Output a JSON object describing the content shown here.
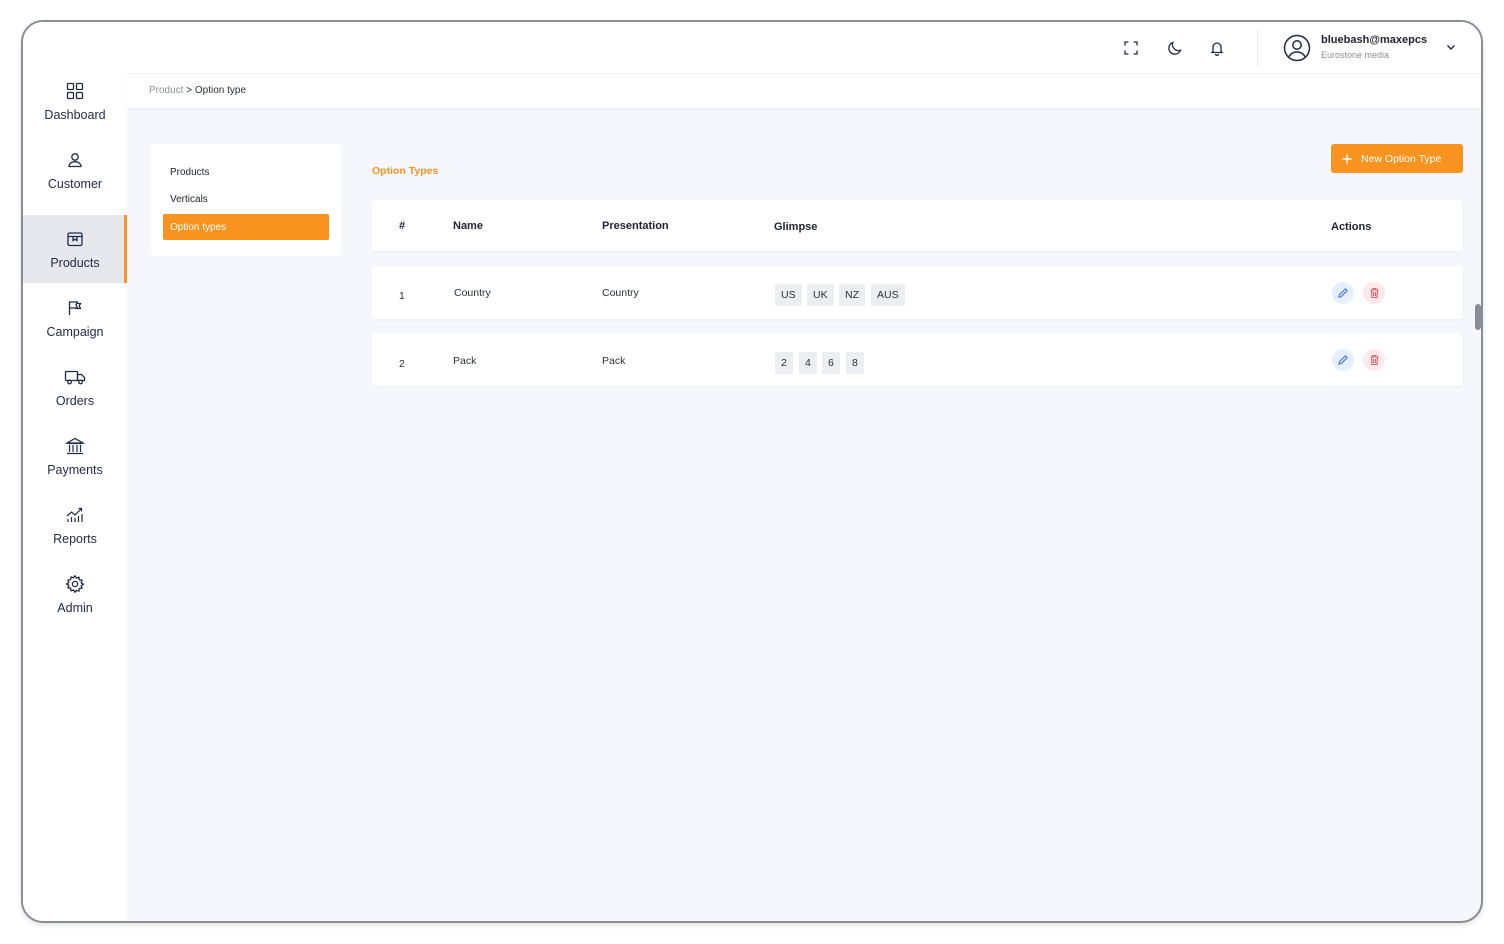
{
  "sidebar": {
    "items": [
      {
        "label": "Dashboard",
        "icon": "dashboard-icon"
      },
      {
        "label": "Customer",
        "icon": "user-icon"
      },
      {
        "label": "Products",
        "icon": "product-box-icon",
        "active": true
      },
      {
        "label": "Campaign",
        "icon": "flag-icon"
      },
      {
        "label": "Orders",
        "icon": "truck-icon"
      },
      {
        "label": "Payments",
        "icon": "bank-icon"
      },
      {
        "label": "Reports",
        "icon": "chart-icon"
      },
      {
        "label": "Admin",
        "icon": "gear-icon"
      }
    ]
  },
  "header": {
    "icons": [
      "fullscreen-icon",
      "moon-icon",
      "bell-icon"
    ],
    "user": {
      "name": "bluebash@maxepcs",
      "org": "Eurostone media"
    }
  },
  "breadcrumb": {
    "parent": "Product",
    "separator": ">",
    "current": "Option type"
  },
  "submenu": {
    "items": [
      {
        "label": "Products"
      },
      {
        "label": "Verticals"
      },
      {
        "label": "Option types",
        "active": true
      }
    ]
  },
  "content": {
    "title": "Option Types",
    "new_button": "New Option Type",
    "columns": [
      "#",
      "Name",
      "Presentation",
      "Glimpse",
      "Actions"
    ],
    "rows": [
      {
        "index": "1",
        "name": "Country",
        "presentation": "Country",
        "glimpse": [
          "US",
          "UK",
          "NZ",
          "AUS"
        ]
      },
      {
        "index": "2",
        "name": "Pack",
        "presentation": "Pack",
        "glimpse": [
          "2",
          "4",
          "6",
          "8"
        ]
      }
    ]
  },
  "colors": {
    "accent": "#f7931e",
    "edit": "#4f7fd6",
    "delete": "#e25d63"
  }
}
